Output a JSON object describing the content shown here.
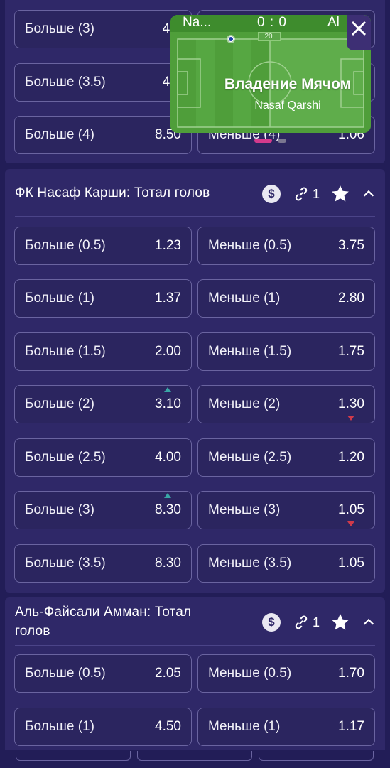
{
  "colors": {
    "page_bg": "#221d57",
    "section_bg": "#2f2868",
    "button_border": "#6a64a0",
    "odds_up": "#3aa6a6",
    "odds_down": "#d03a4a",
    "widget_green": "#4f9e3a"
  },
  "top_section": {
    "rows": [
      {
        "over_label": "Больше (3)",
        "over_odds": "4.0",
        "under_label": "",
        "under_odds": ""
      },
      {
        "over_label": "Больше (3.5)",
        "over_odds": "4.9",
        "under_label": "",
        "under_odds": ""
      },
      {
        "over_label": "Больше (4)",
        "over_odds": "8.50",
        "under_label": "Меньше (4)",
        "under_odds": "1.06"
      }
    ]
  },
  "widget": {
    "team1": "Na...",
    "score": "0 : 0",
    "team2": "Al",
    "time": "20'",
    "title": "Владение Мячом",
    "subtitle": "Nasaf Qarshi",
    "close_icon": "close-icon"
  },
  "section1": {
    "title": "ФК Насаф Карши: Тотал голов",
    "link_count": "1",
    "icons": [
      "dollar-icon",
      "link-icon",
      "star-icon",
      "chevron-up-icon"
    ],
    "rows": [
      {
        "over_label": "Больше (0.5)",
        "over_odds": "1.23",
        "under_label": "Меньше (0.5)",
        "under_odds": "3.75"
      },
      {
        "over_label": "Больше (1)",
        "over_odds": "1.37",
        "under_label": "Меньше (1)",
        "under_odds": "2.80"
      },
      {
        "over_label": "Больше (1.5)",
        "over_odds": "2.00",
        "under_label": "Меньше (1.5)",
        "under_odds": "1.75"
      },
      {
        "over_label": "Больше (2)",
        "over_odds": "3.10",
        "under_label": "Меньше (2)",
        "under_odds": "1.30"
      },
      {
        "over_label": "Больше (2.5)",
        "over_odds": "4.00",
        "under_label": "Меньше (2.5)",
        "under_odds": "1.20"
      },
      {
        "over_label": "Больше (3)",
        "over_odds": "8.30",
        "under_label": "Меньше (3)",
        "under_odds": "1.05"
      },
      {
        "over_label": "Больше (3.5)",
        "over_odds": "8.30",
        "under_label": "Меньше (3.5)",
        "under_odds": "1.05"
      }
    ]
  },
  "section2": {
    "title_line1": "Аль-Файсали Амман: Тотал",
    "title_line2": "голов",
    "link_count": "1",
    "rows": [
      {
        "over_label": "Больше (0.5)",
        "over_odds": "2.05",
        "under_label": "Меньше (0.5)",
        "under_odds": "1.70"
      },
      {
        "over_label": "Больше (1)",
        "over_odds": "4.50",
        "under_label": "Меньше (1)",
        "under_odds": "1.17"
      }
    ]
  }
}
